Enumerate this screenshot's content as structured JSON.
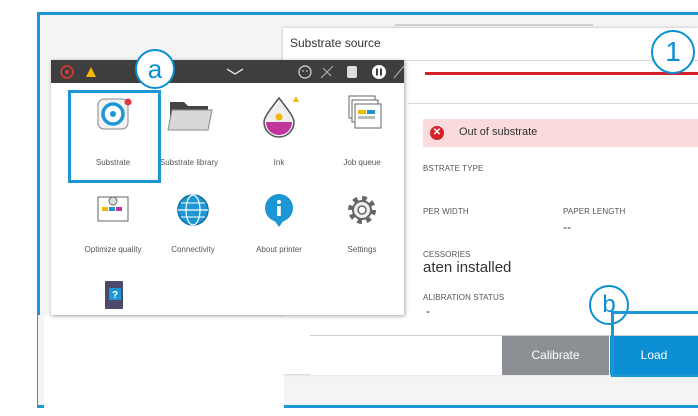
{
  "back_window": {
    "title": "Substrate source",
    "alert": "Out of substrate",
    "substrate_type_label": "BSTRATE TYPE",
    "paper_width_label": "PER WIDTH",
    "paper_length_label": "PAPER LENGTH",
    "paper_length_value": "--",
    "accessories_label": "CESSORIES",
    "accessories_value": "aten installed",
    "calibration_label": "ALIBRATION STATUS",
    "calibration_value": "-",
    "calibrate_button": "Calibrate",
    "load_button": "Load"
  },
  "home_panel": {
    "items": [
      {
        "label": "Substrate",
        "icon": "substrate-roll-icon"
      },
      {
        "label": "Substrate library",
        "icon": "folder-icon"
      },
      {
        "label": "Ink",
        "icon": "ink-drop-icon"
      },
      {
        "label": "Job queue",
        "icon": "job-queue-icon"
      },
      {
        "label": "Optimize quality",
        "icon": "optimize-quality-icon"
      },
      {
        "label": "Connectivity",
        "icon": "globe-icon"
      },
      {
        "label": "About printer",
        "icon": "info-icon"
      },
      {
        "label": "Settings",
        "icon": "gear-icon"
      },
      {
        "label": "",
        "icon": "help-book-icon"
      }
    ]
  },
  "callouts": {
    "one": "1",
    "a": "a",
    "b": "b"
  },
  "colors": {
    "accent": "#1c97d3",
    "alert_red": "#d3222a",
    "load_blue": "#0b8ed3"
  }
}
